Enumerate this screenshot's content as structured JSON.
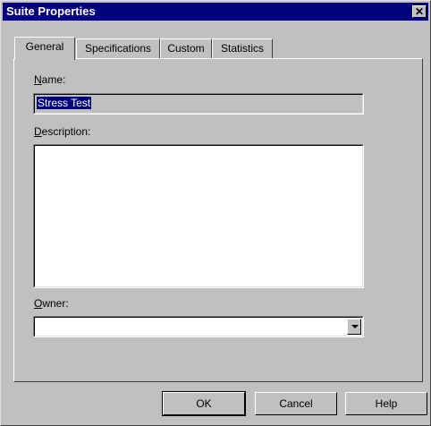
{
  "window": {
    "title": "Suite Properties",
    "close_glyph": "✕"
  },
  "tabs": [
    {
      "label": "General",
      "active": true
    },
    {
      "label": "Specifications",
      "active": false
    },
    {
      "label": "Custom",
      "active": false
    },
    {
      "label": "Statistics",
      "active": false
    }
  ],
  "general": {
    "name_label_mnemonic": "N",
    "name_label_rest": "ame:",
    "name_value": "Stress Test",
    "description_label_mnemonic": "D",
    "description_label_rest": "escription:",
    "description_value": "",
    "owner_label_mnemonic": "O",
    "owner_label_rest": "wner:",
    "owner_value": ""
  },
  "buttons": {
    "ok": "OK",
    "cancel": "Cancel",
    "help": "Help"
  },
  "icons": {
    "close": "close-icon",
    "dropdown": "chevron-down-icon"
  },
  "colors": {
    "titlebar": "#000080",
    "face": "#c0c0c0",
    "selection": "#000080"
  }
}
